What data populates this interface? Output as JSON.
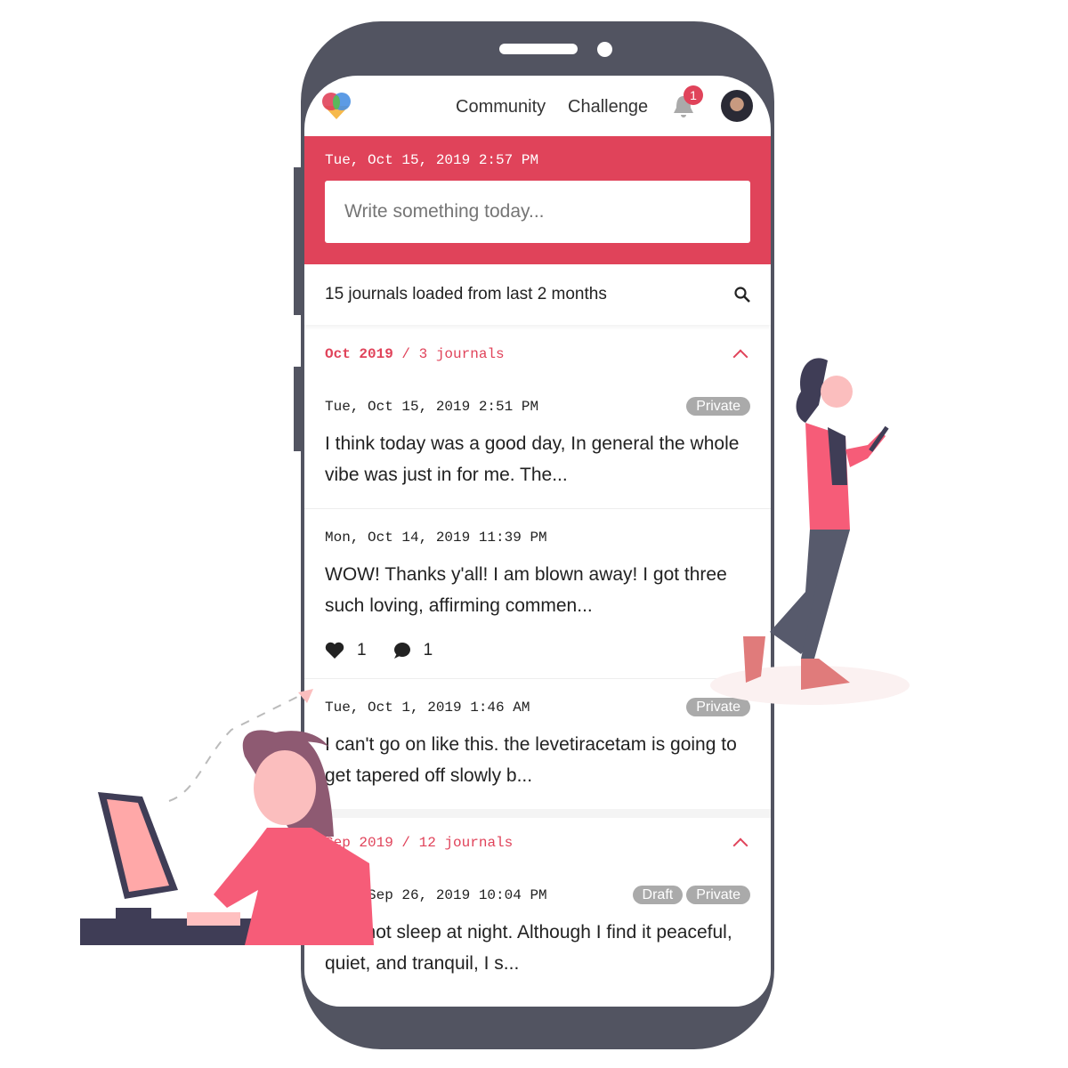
{
  "nav": {
    "links": [
      "Community",
      "Challenge"
    ],
    "notifications": "1"
  },
  "composer": {
    "datetime": "Tue, Oct 15, 2019 2:57 PM",
    "placeholder": "Write something today..."
  },
  "summary": {
    "text": "15 journals loaded from last 2 months"
  },
  "groups": [
    {
      "month": "Oct 2019",
      "count": "/ 3 journals"
    },
    {
      "month": "Sep 2019",
      "count": "/ 12 journals"
    }
  ],
  "entries": [
    {
      "date": "Tue, Oct 15, 2019 2:51 PM",
      "tags": [
        "Private"
      ],
      "text": "I think today was a good day, In general the whole vibe was just in for me. The..."
    },
    {
      "date": "Mon, Oct 14, 2019 11:39 PM",
      "tags": [],
      "text": "WOW! Thanks y'all! I am blown away! I got three such loving, affirming commen...",
      "likes": "1",
      "comments": "1"
    },
    {
      "date": "Tue, Oct 1, 2019 1:46 AM",
      "tags": [
        "Private"
      ],
      "text": "I can't go on like this. the levetiracetam is going to get tapered off slowly b..."
    },
    {
      "date": "Thu, Sep 26, 2019 10:04 PM",
      "tags": [
        "Draft",
        "Private"
      ],
      "text": "I cannot sleep at night. Although I find it peaceful, quiet, and tranquil, I s..."
    }
  ],
  "colors": {
    "accent": "#e0435a",
    "phone": "#525461",
    "tag": "#aaaaaa"
  }
}
